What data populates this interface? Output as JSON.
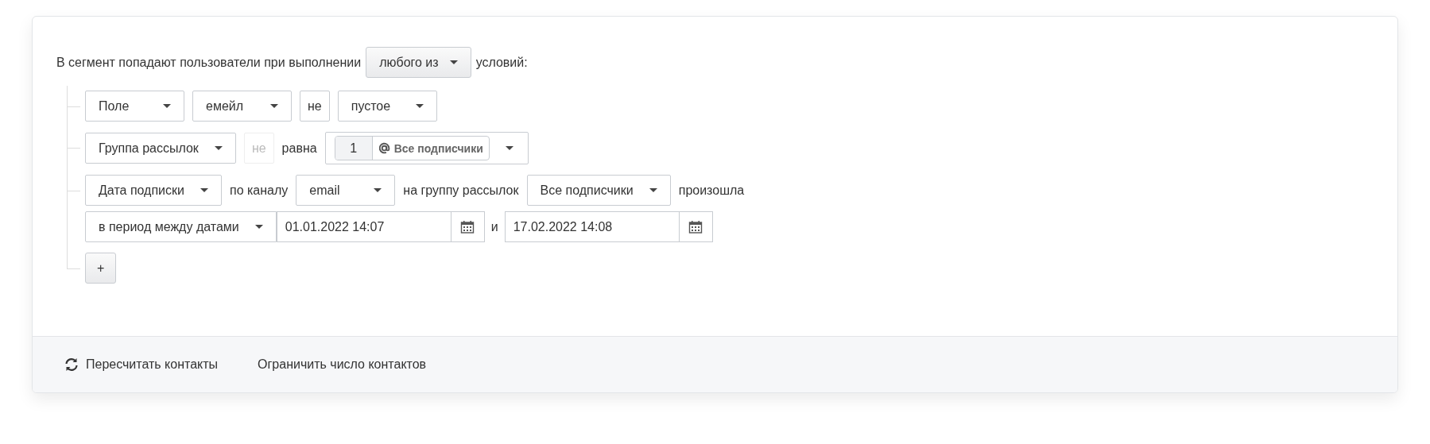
{
  "intro": {
    "before": "В сегмент попадают пользователи при выполнении",
    "mode": "любого из",
    "after": "условий:"
  },
  "conditions": [
    {
      "lines": [
        [
          {
            "kind": "select",
            "value": "Поле"
          },
          {
            "kind": "select",
            "value": "емейл"
          },
          {
            "kind": "toggle",
            "label": "не",
            "on": true
          },
          {
            "kind": "select",
            "value": "пустое"
          }
        ]
      ]
    },
    {
      "lines": [
        [
          {
            "kind": "select",
            "value": "Группа рассылок"
          },
          {
            "kind": "toggle",
            "label": "не",
            "on": false
          },
          {
            "kind": "text",
            "text": "равна"
          },
          {
            "kind": "tags",
            "count": "1",
            "label": "Все подписчики"
          }
        ]
      ]
    },
    {
      "lines": [
        [
          {
            "kind": "select",
            "value": "Дата подписки"
          },
          {
            "kind": "text",
            "text": "по каналу"
          },
          {
            "kind": "select",
            "value": "email"
          },
          {
            "kind": "text",
            "text": "на группу рассылок"
          },
          {
            "kind": "select",
            "value": "Все подписчики"
          },
          {
            "kind": "text",
            "text": "произошла"
          }
        ],
        [
          {
            "kind": "select",
            "value": "в период между датами"
          },
          {
            "kind": "date",
            "value": "01.01.2022 14:07"
          },
          {
            "kind": "conjunction",
            "text": "и"
          },
          {
            "kind": "date",
            "value": "17.02.2022 14:08"
          }
        ]
      ]
    }
  ],
  "add_button": "+",
  "footer": {
    "recalc": "Пересчитать контакты",
    "limit": "Ограничить число контактов"
  }
}
